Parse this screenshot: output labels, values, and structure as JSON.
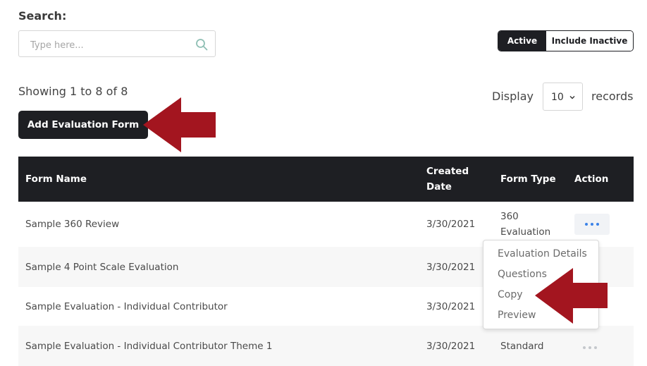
{
  "search": {
    "label": "Search:",
    "placeholder": "Type here..."
  },
  "toggle": {
    "active_label": "Active",
    "inactive_label": "Include Inactive"
  },
  "summary": {
    "showing_text": "Showing 1 to 8 of 8"
  },
  "display": {
    "label": "Display",
    "selected": "10",
    "suffix": "records"
  },
  "actions": {
    "add_button": "Add Evaluation Form"
  },
  "table": {
    "headers": {
      "name": "Form Name",
      "created_line1": "Created",
      "created_line2": "Date",
      "type": "Form Type",
      "action": "Action"
    },
    "rows": [
      {
        "name": "Sample 360 Review",
        "date": "3/30/2021",
        "type_line1": "360",
        "type_line2": "Evaluation"
      },
      {
        "name": "Sample 4 Point Scale Evaluation",
        "date": "3/30/2021"
      },
      {
        "name": "Sample Evaluation - Individual Contributor",
        "date": "3/30/2021"
      },
      {
        "name": "Sample Evaluation - Individual Contributor Theme 1",
        "date": "3/30/2021",
        "type": "Standard"
      }
    ]
  },
  "menu": {
    "items": [
      "Evaluation Details",
      "Questions",
      "Copy",
      "Preview"
    ]
  },
  "colors": {
    "dark": "#1e1f23",
    "arrow": "#a3151f",
    "dots_active": "#3b82e8"
  }
}
